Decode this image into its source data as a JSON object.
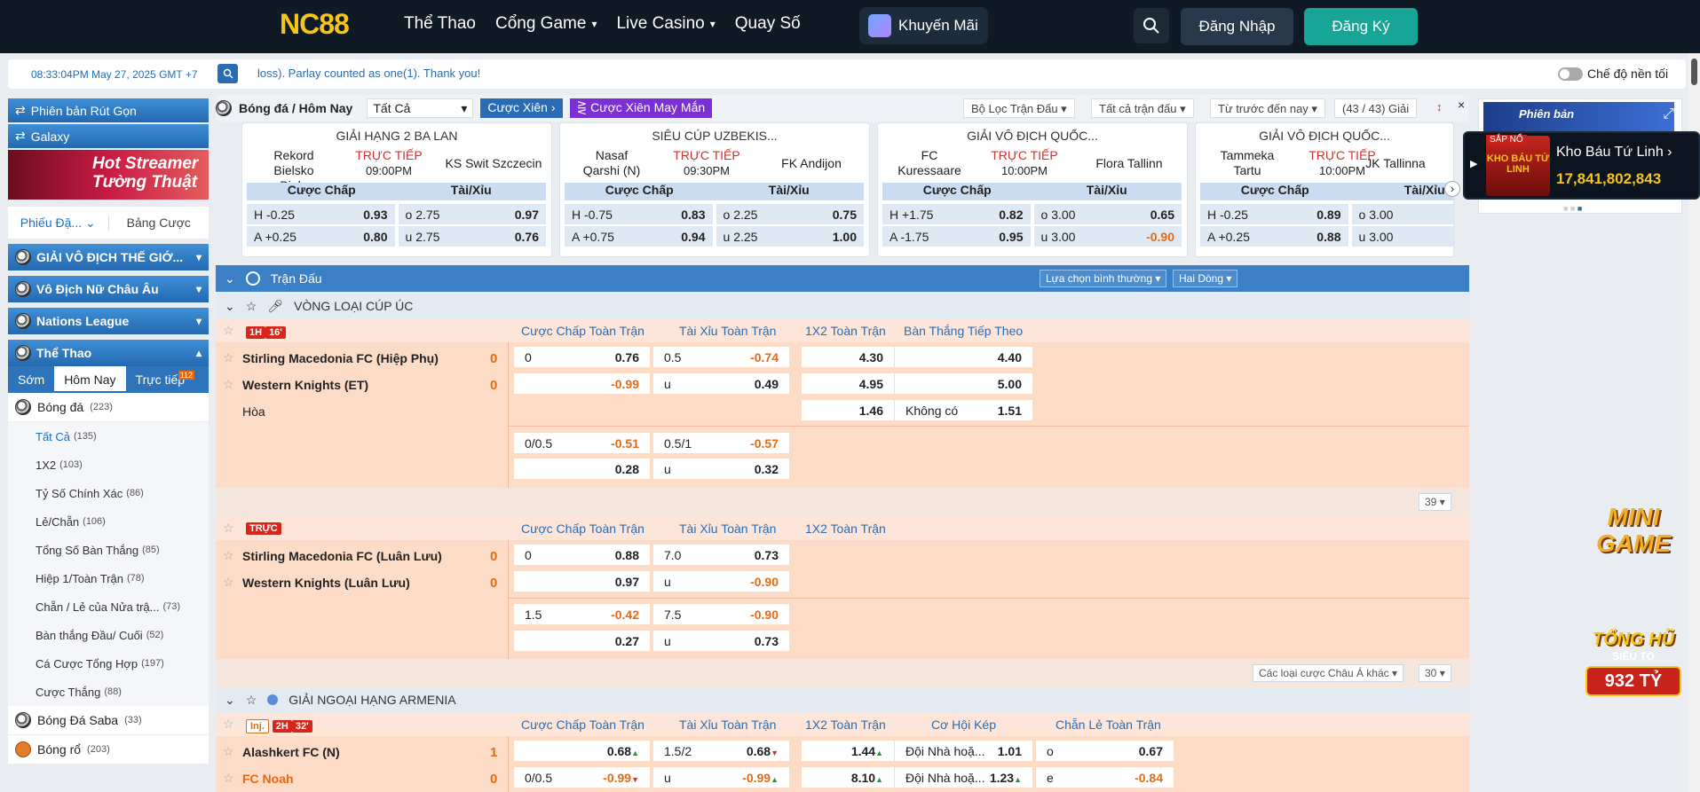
{
  "header": {
    "logo_a": "NC",
    "logo_b": "88",
    "nav": [
      {
        "label": "Thể Thao",
        "chev": ""
      },
      {
        "label": "Cổng Game",
        "chev": "⌄"
      },
      {
        "label": "Live Casino",
        "chev": "⌄"
      },
      {
        "label": "Quay Số",
        "chev": ""
      }
    ],
    "promo": "Khuyến Mãi",
    "login": "Đăng Nhập",
    "register": "Đăng Ký"
  },
  "infobar": {
    "clock": "08:33:04PM May 27, 2025 GMT +7",
    "ticker": "loss). Parlay counted as one(1). Thank you!",
    "dark_mode": "Chế độ nền tối"
  },
  "sidebar": {
    "btn1": "Phiên bản Rút Gọn",
    "btn2": "Galaxy",
    "banner": "Hot Streamer Tường Thuật",
    "tab_betslip": "Phiếu Đặ...",
    "tab_table": "Bảng Cược",
    "groups": [
      "GIẢI VÔ ĐỊCH THẾ GIỚ...",
      "Vô Địch Nữ Châu Âu",
      "Nations League",
      "Thể Thao"
    ],
    "subtabs": {
      "early": "Sớm",
      "today": "Hôm Nay",
      "live": "Trực tiếp",
      "live_count": "112"
    },
    "sport": {
      "label": "Bóng đá",
      "count": "(223)"
    },
    "items": [
      {
        "label": "Tất Cả",
        "count": "(135)"
      },
      {
        "label": "1X2",
        "count": "(103)"
      },
      {
        "label": "Tỷ Số Chính Xác",
        "count": "(86)"
      },
      {
        "label": "Lẻ/Chẵn",
        "count": "(106)"
      },
      {
        "label": "Tổng Số Bàn Thắng",
        "count": "(85)"
      },
      {
        "label": "Hiệp 1/Toàn Trận",
        "count": "(78)"
      },
      {
        "label": "Chẵn / Lẻ của Nửa trậ...",
        "count": "(73)"
      },
      {
        "label": "Bàn thắng Đầu/ Cuối",
        "count": "(52)"
      },
      {
        "label": "Cá Cược Tổng Hợp",
        "count": "(197)"
      },
      {
        "label": "Cược Thắng",
        "count": "(88)"
      }
    ],
    "sport2": {
      "label": "Bóng Đá Saba",
      "count": "(33)"
    },
    "sport3": {
      "label": "Bóng rổ",
      "count": "(203)"
    }
  },
  "crumbs": {
    "title": "Bóng đá / Hôm Nay",
    "select": "Tất Cả",
    "parlay": "Cược Xiên",
    "lucky": "Cược Xiên May Mắn",
    "filter1": "Bộ Lọc Trận Đấu",
    "filter2": "Tất cả trận đấu",
    "filter3": "Từ trước đến nay",
    "count": "(43 / 43) Giải"
  },
  "featured": [
    {
      "league": "GIẢI HẠNG 2 BA LAN",
      "home": "Rekord Bielsko Biala",
      "away": "KS Swit Szczecin",
      "status": "TRỰC TIẾP",
      "time": "09:00PM",
      "hdr1": "Cược Chấp",
      "hdr2": "Tài/Xỉu",
      "r1": [
        "H",
        "-0.25",
        "0.93",
        "o",
        "2.75",
        "0.97"
      ],
      "r2": [
        "A",
        "+0.25",
        "0.80",
        "u",
        "2.75",
        "0.76"
      ]
    },
    {
      "league": "SIÊU CÚP UZBEKIS...",
      "home": "Nasaf Qarshi (N)",
      "away": "FK Andijon",
      "status": "TRỰC TIẾP",
      "time": "09:30PM",
      "hdr1": "Cược Chấp",
      "hdr2": "Tài/Xỉu",
      "r1": [
        "H",
        "-0.75",
        "0.83",
        "o",
        "2.25",
        "0.75"
      ],
      "r2": [
        "A",
        "+0.75",
        "0.94",
        "u",
        "2.25",
        "1.00"
      ]
    },
    {
      "league": "GIẢI VÔ ĐỊCH QUỐC...",
      "home": "FC Kuressaare",
      "away": "Flora Tallinn",
      "status": "TRỰC TIẾP",
      "time": "10:00PM",
      "hdr1": "Cược Chấp",
      "hdr2": "Tài/Xỉu",
      "r1": [
        "H",
        "+1.75",
        "0.82",
        "o",
        "3.00",
        "0.65"
      ],
      "r2": [
        "A",
        "-1.75",
        "0.95",
        "u",
        "3.00",
        "-0.90"
      ]
    },
    {
      "league": "GIẢI VÔ ĐỊCH QUỐC...",
      "home": "Tammeka Tartu",
      "away": "JK Tallinna",
      "status": "TRỰC TIẾP",
      "time": "10:00PM",
      "hdr1": "Cược Chấp",
      "hdr2": "Tài/Xỉu",
      "r1": [
        "H",
        "-0.25",
        "0.89",
        "o",
        "3.00",
        ""
      ],
      "r2": [
        "A",
        "+0.25",
        "0.88",
        "u",
        "3.00",
        ""
      ]
    }
  ],
  "section": {
    "title": "Trận Đấu",
    "opt1": "Lựa chọn bình thường",
    "opt2": "Hai Dòng"
  },
  "league1": "VÒNG LOẠI CÚP ÚC",
  "cols": {
    "hdp": "Cược Chấp Toàn Trận",
    "ou": "Tài Xỉu Toàn Trận",
    "x12": "1X2 Toàn Trận",
    "next": "Bàn Thắng Tiếp Theo",
    "dc": "Cơ Hội Kép",
    "oe": "Chẵn Lẻ Toàn Trận"
  },
  "m1": {
    "tag1": "1H",
    "tag2": "16'",
    "home": "Stirling Macedonia FC (Hiệp Phụ)",
    "away": "Western Knights (ET)",
    "hs": "0",
    "as": "0",
    "draw": "Hòa",
    "h1": [
      "0",
      "0.76"
    ],
    "o1": [
      "0.5",
      "-0.74"
    ],
    "x1": "4.30",
    "n1": "4.40",
    "h2": [
      "",
      "-0.99"
    ],
    "o2": [
      "u",
      "0.49"
    ],
    "x2": "4.95",
    "n2": "5.00",
    "x3": "1.46",
    "n3": [
      "Không có",
      "1.51"
    ],
    "h3": [
      "0/0.5",
      "-0.51"
    ],
    "o3": [
      "0.5/1",
      "-0.57"
    ],
    "h4": [
      "",
      "0.28"
    ],
    "o4": [
      "u",
      "0.32"
    ],
    "more": "39"
  },
  "m2": {
    "tag": "TRỰC",
    "home": "Stirling Macedonia FC (Luân Lưu)",
    "away": "Western Knights (Luân Lưu)",
    "hs": "0",
    "as": "0",
    "h1": [
      "0",
      "0.88"
    ],
    "o1": [
      "7.0",
      "0.73"
    ],
    "h2": [
      "",
      "0.97"
    ],
    "o2": [
      "u",
      "-0.90"
    ],
    "h3": [
      "1.5",
      "-0.42"
    ],
    "o3": [
      "7.5",
      "-0.90"
    ],
    "h4": [
      "",
      "0.27"
    ],
    "o4": [
      "u",
      "0.73"
    ],
    "other": "Các loại cược Châu Á khác",
    "more": "30"
  },
  "league2": "GIẢI NGOẠI HẠNG ARMENIA",
  "m3": {
    "tag1": "Inj.",
    "tag2": "2H",
    "tag3": "32'",
    "home": "Alashkert FC (N)",
    "away": "FC Noah",
    "hs": "1",
    "as": "0",
    "h1": [
      "",
      "0.68"
    ],
    "o1": [
      "1.5/2",
      "0.68"
    ],
    "x1": "1.44",
    "d1": [
      "Đội Nhà hoặ...",
      "1.01"
    ],
    "e1": [
      "o",
      "0.67"
    ],
    "h2": [
      "0/0.5",
      "-0.99"
    ],
    "o2": [
      "u",
      "-0.99"
    ],
    "x2": "8.10",
    "d2": [
      "Đội Nhà hoặ...",
      "1.23"
    ],
    "e2": [
      "e",
      "-0.84"
    ]
  },
  "right": {
    "jp_badge": "SẮP NỔ",
    "jp_img": "KHO BÁU TỨ LINH",
    "jp_name": "Kho Báu Tứ Linh",
    "jp_value": "17,841,802,843",
    "banner": "Phiên bản",
    "mini": "MINI GAME",
    "tonghu": "TỔNG HŨ",
    "sieuto": "SIÊU TO",
    "amount": "932 TỶ"
  }
}
